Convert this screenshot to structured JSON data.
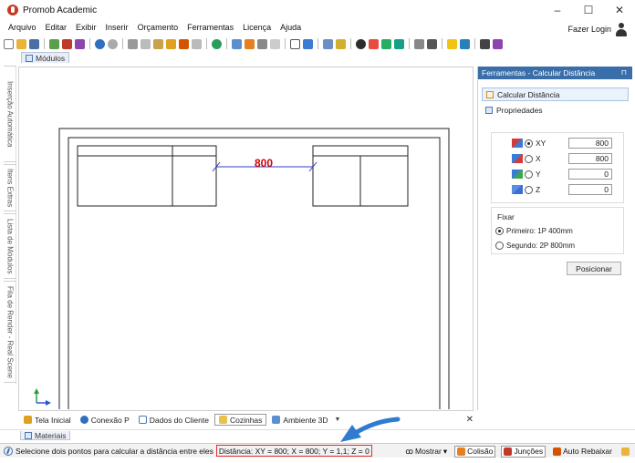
{
  "window": {
    "title": "Promob Academic",
    "controls": [
      "–",
      "☐",
      "✕"
    ]
  },
  "menu": [
    "Arquivo",
    "Editar",
    "Exibir",
    "Inserir",
    "Orçamento",
    "Ferramentas",
    "Licença",
    "Ajuda"
  ],
  "account": {
    "login_label": "Fazer Login"
  },
  "document_tab": {
    "label": "Módulos"
  },
  "left_tabs": [
    "Inserção Automática",
    "Itens Extras",
    "Lista de Módulos",
    "Fila de Render - Real Scene"
  ],
  "viewport": {
    "dimension_label": "800"
  },
  "right_panel": {
    "header": "Ferramentas - Calcular Distância",
    "pin": "⊓",
    "tab_calc": "Calcular Distância",
    "tab_props": "Propriedades",
    "coords": [
      {
        "axis": "XY",
        "selected": true,
        "value": "800",
        "icon": "xy-axis-icon",
        "color": "#3a7bd5"
      },
      {
        "axis": "X",
        "selected": false,
        "value": "800",
        "icon": "x-axis-icon",
        "color": "#d23b3b"
      },
      {
        "axis": "Y",
        "selected": false,
        "value": "0",
        "icon": "y-axis-icon",
        "color": "#3aa84a"
      },
      {
        "axis": "Z",
        "selected": false,
        "value": "0",
        "icon": "z-axis-icon",
        "color": "#3a6ed5"
      }
    ],
    "fix_label": "Fixar",
    "fix_options": [
      {
        "label": "Primeiro: 1P 400mm",
        "selected": true
      },
      {
        "label": "Segundo: 2P 800mm",
        "selected": false
      }
    ],
    "position_button": "Posicionar"
  },
  "bottom_tabs": [
    {
      "label": "Tela Inicial",
      "icon": "home-icon",
      "selected": false
    },
    {
      "label": "Conexão P",
      "icon": "connection-icon",
      "selected": false
    },
    {
      "label": "Dados do Cliente",
      "icon": "client-data-icon",
      "selected": false
    },
    {
      "label": "Cozinhas",
      "icon": "folder-icon",
      "selected": true
    },
    {
      "label": "Ambiente 3D",
      "icon": "3d-environment-icon",
      "selected": false
    }
  ],
  "materials_tab": "Materiais",
  "status": {
    "message": "Selecione dois pontos para calcular a distância entre eles",
    "distance": "Distância: XY = 800; X = 800; Y = 1,1; Z = 0",
    "show_menu": "Mostrar",
    "collision": "Colisão",
    "joints": "Junções",
    "auto_lower": "Auto Rebaixar"
  },
  "colors": {
    "accent": "#3a6ea8",
    "dimension": "#d10000",
    "highlight": "#e03030",
    "arrow": "#2f7ccf"
  }
}
